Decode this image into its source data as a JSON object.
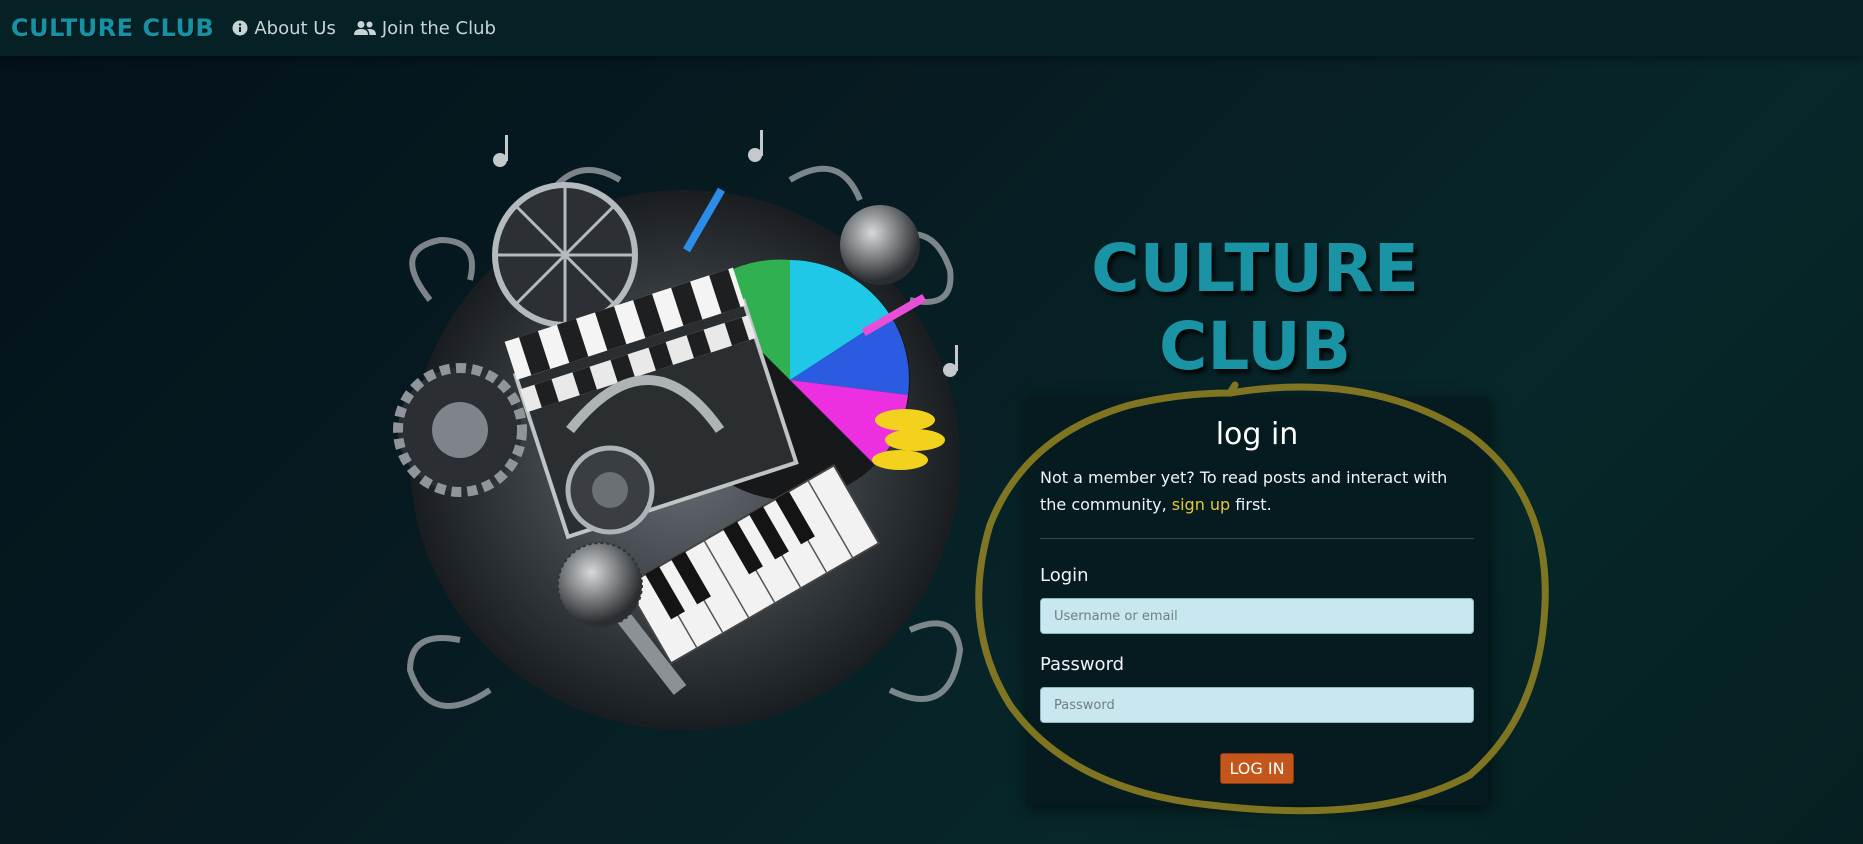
{
  "navbar": {
    "brand": "CULTURE CLUB",
    "links": [
      {
        "label": "About Us",
        "icon": "info-circle-icon"
      },
      {
        "label": "Join the Club",
        "icon": "users-icon"
      }
    ]
  },
  "hero": {
    "title_line1": "CULTURE",
    "title_line2": "CLUB"
  },
  "login": {
    "heading": "log in",
    "intro_before": "Not a member yet? To read posts and interact with the community, ",
    "intro_link": "sign up",
    "intro_after": " first.",
    "username_label": "Login",
    "username_placeholder": "Username or email",
    "password_label": "Password",
    "password_placeholder": "Password",
    "submit_label": "LOG IN"
  },
  "colors": {
    "brand": "#1592a3",
    "link": "#e8c63a",
    "button": "#c4561c",
    "input_bg": "#c9e7ef",
    "annotation": "#8a7d22"
  }
}
